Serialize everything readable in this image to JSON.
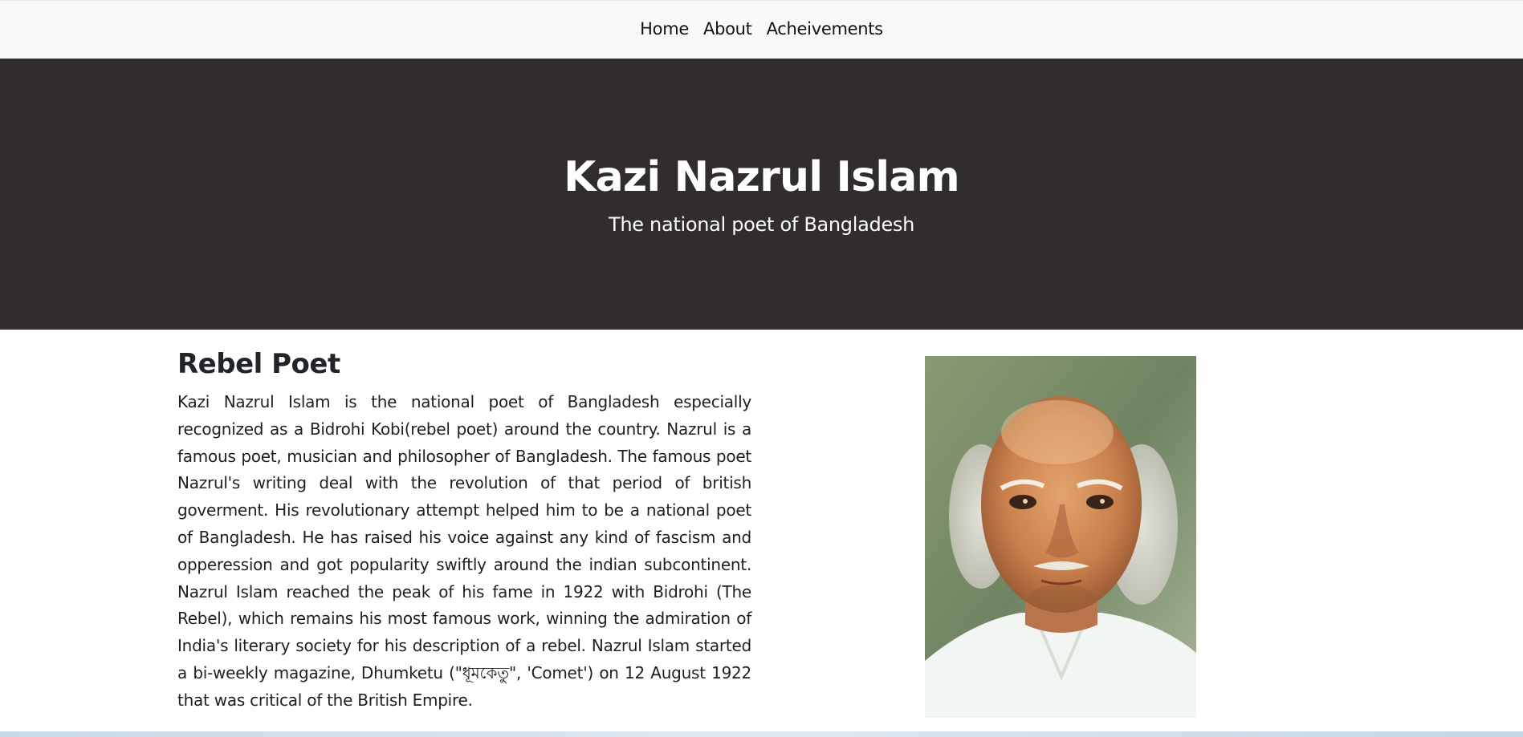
{
  "nav": {
    "items": [
      {
        "label": "Home"
      },
      {
        "label": "About"
      },
      {
        "label": "Acheivements"
      }
    ]
  },
  "hero": {
    "title": "Kazi Nazrul Islam",
    "subtitle": "The national poet of Bangladesh"
  },
  "about": {
    "heading": "Rebel Poet",
    "paragraph": "Kazi Nazrul Islam is the national poet of Bangladesh especially recognized as a Bidrohi Kobi(rebel poet) around the country. Nazrul is a famous poet, musician and philosopher of Bangladesh. The famous poet Nazrul's writing deal with the revolution of that period of british goverment. His revolutionary attempt helped him to be a national poet of Bangladesh. He has raised his voice against any kind of fascism and opperession and got popularity swiftly around the indian subcontinent. Nazrul Islam reached the peak of his fame in 1922 with Bidrohi (The Rebel), which remains his most famous work, winning the admiration of India's literary society for his description of a rebel. Nazrul Islam started a bi-weekly magazine, Dhumketu (\"ধূমকেতু\", 'Comet') on 12 August 1922 that was critical of the British Empire."
  },
  "colors": {
    "navbar_bg": "#f8f9fa",
    "hero_bg": "#302d2c",
    "hero_text": "#ffffff",
    "body_text": "#212529"
  }
}
